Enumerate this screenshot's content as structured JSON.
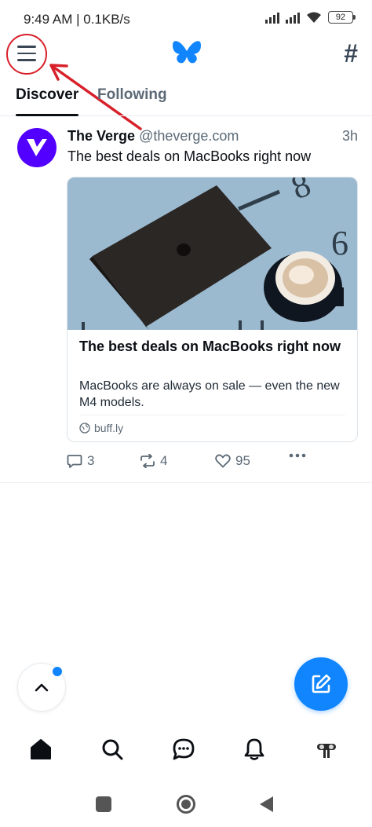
{
  "status_bar": {
    "time_and_speed": "9:49 AM | 0.1KB/s",
    "battery": "92"
  },
  "header": {
    "menu_icon": "hamburger-menu-icon",
    "logo_icon": "butterfly-logo-icon",
    "feeds_icon": "hash-icon",
    "accent_color": "#1185fe",
    "annotation_color": "#d8202a"
  },
  "tabs": [
    {
      "label": "Discover",
      "selected": true
    },
    {
      "label": "Following",
      "selected": false
    }
  ],
  "post": {
    "author_name": "The Verge",
    "handle": "@theverge.com",
    "time": "3h",
    "text": "The best deals on MacBooks right now",
    "embed": {
      "title": "The best deals on MacBooks right now",
      "description": "MacBooks are always on sale — even the new M4 models.",
      "domain": "buff.ly"
    },
    "replies": "3",
    "reposts": "4",
    "likes": "95"
  },
  "bottom_nav": [
    "home-icon",
    "search-icon",
    "chat-icon",
    "bell-icon",
    "profile-icon"
  ]
}
